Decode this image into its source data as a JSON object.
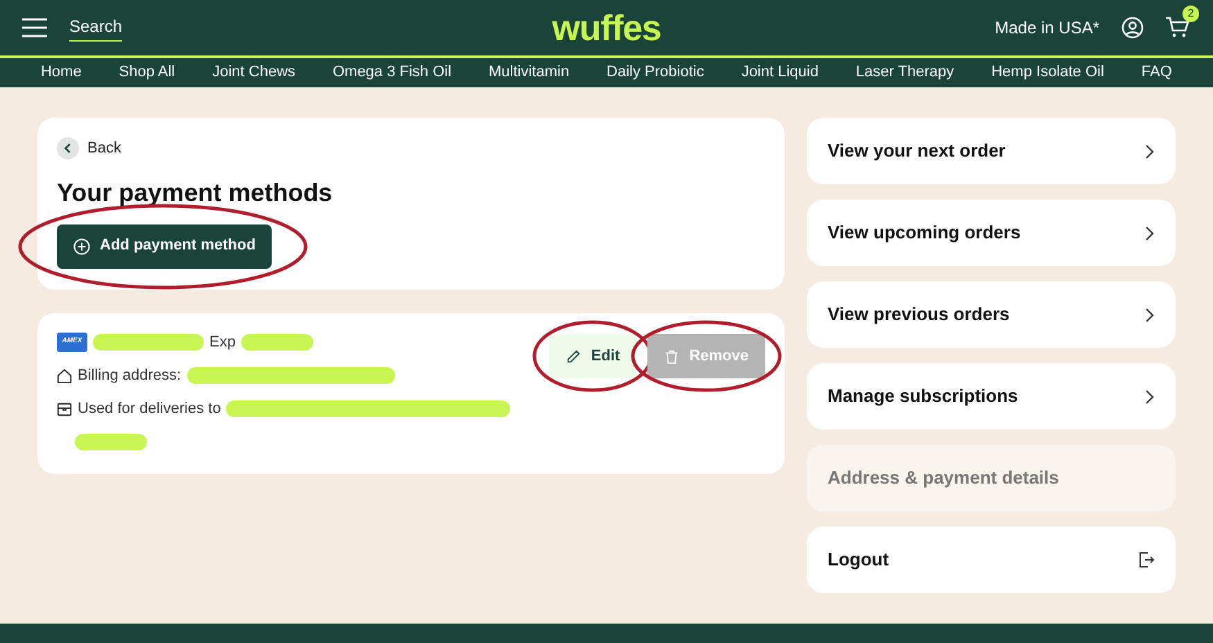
{
  "header": {
    "search": "Search",
    "logo": "wuffes",
    "region": "Made in USA*",
    "cart_count": "2"
  },
  "nav": [
    "Home",
    "Shop All",
    "Joint Chews",
    "Omega 3 Fish Oil",
    "Multivitamin",
    "Daily Probiotic",
    "Joint Liquid",
    "Laser Therapy",
    "Hemp Isolate Oil",
    "FAQ"
  ],
  "payment": {
    "back": "Back",
    "title": "Your payment methods",
    "add_button": {
      "label": "Add payment method",
      "circled": true
    }
  },
  "card": {
    "brand": "AMEX",
    "lines": [
      {
        "segments": [
          {
            "kind": "redacted"
          },
          {
            "kind": "text",
            "text": "Exp"
          },
          {
            "kind": "redacted"
          }
        ]
      },
      {
        "segments": [
          {
            "kind": "text",
            "text": "Billing address:"
          },
          {
            "kind": "redacted"
          }
        ]
      },
      {
        "segments": [
          {
            "kind": "text",
            "text": "Used for deliveries to"
          },
          {
            "kind": "redacted"
          }
        ]
      },
      {
        "segments": [
          {
            "kind": "redacted"
          }
        ]
      }
    ],
    "buttons": [
      {
        "label": "Edit",
        "kind": "edit",
        "disabled": false,
        "circled": true
      },
      {
        "label": "Remove",
        "kind": "remove",
        "disabled": true,
        "circled": true
      }
    ]
  },
  "menu": [
    {
      "label": "View your next order",
      "kind": "link",
      "selected": false
    },
    {
      "label": "View upcoming orders",
      "kind": "link",
      "selected": false
    },
    {
      "label": "View previous orders",
      "kind": "link",
      "selected": false
    },
    {
      "label": "Manage subscriptions",
      "kind": "link",
      "selected": false
    },
    {
      "label": "Address & payment details",
      "kind": "current",
      "selected": true
    },
    {
      "label": "Logout",
      "kind": "logout",
      "selected": false
    }
  ]
}
